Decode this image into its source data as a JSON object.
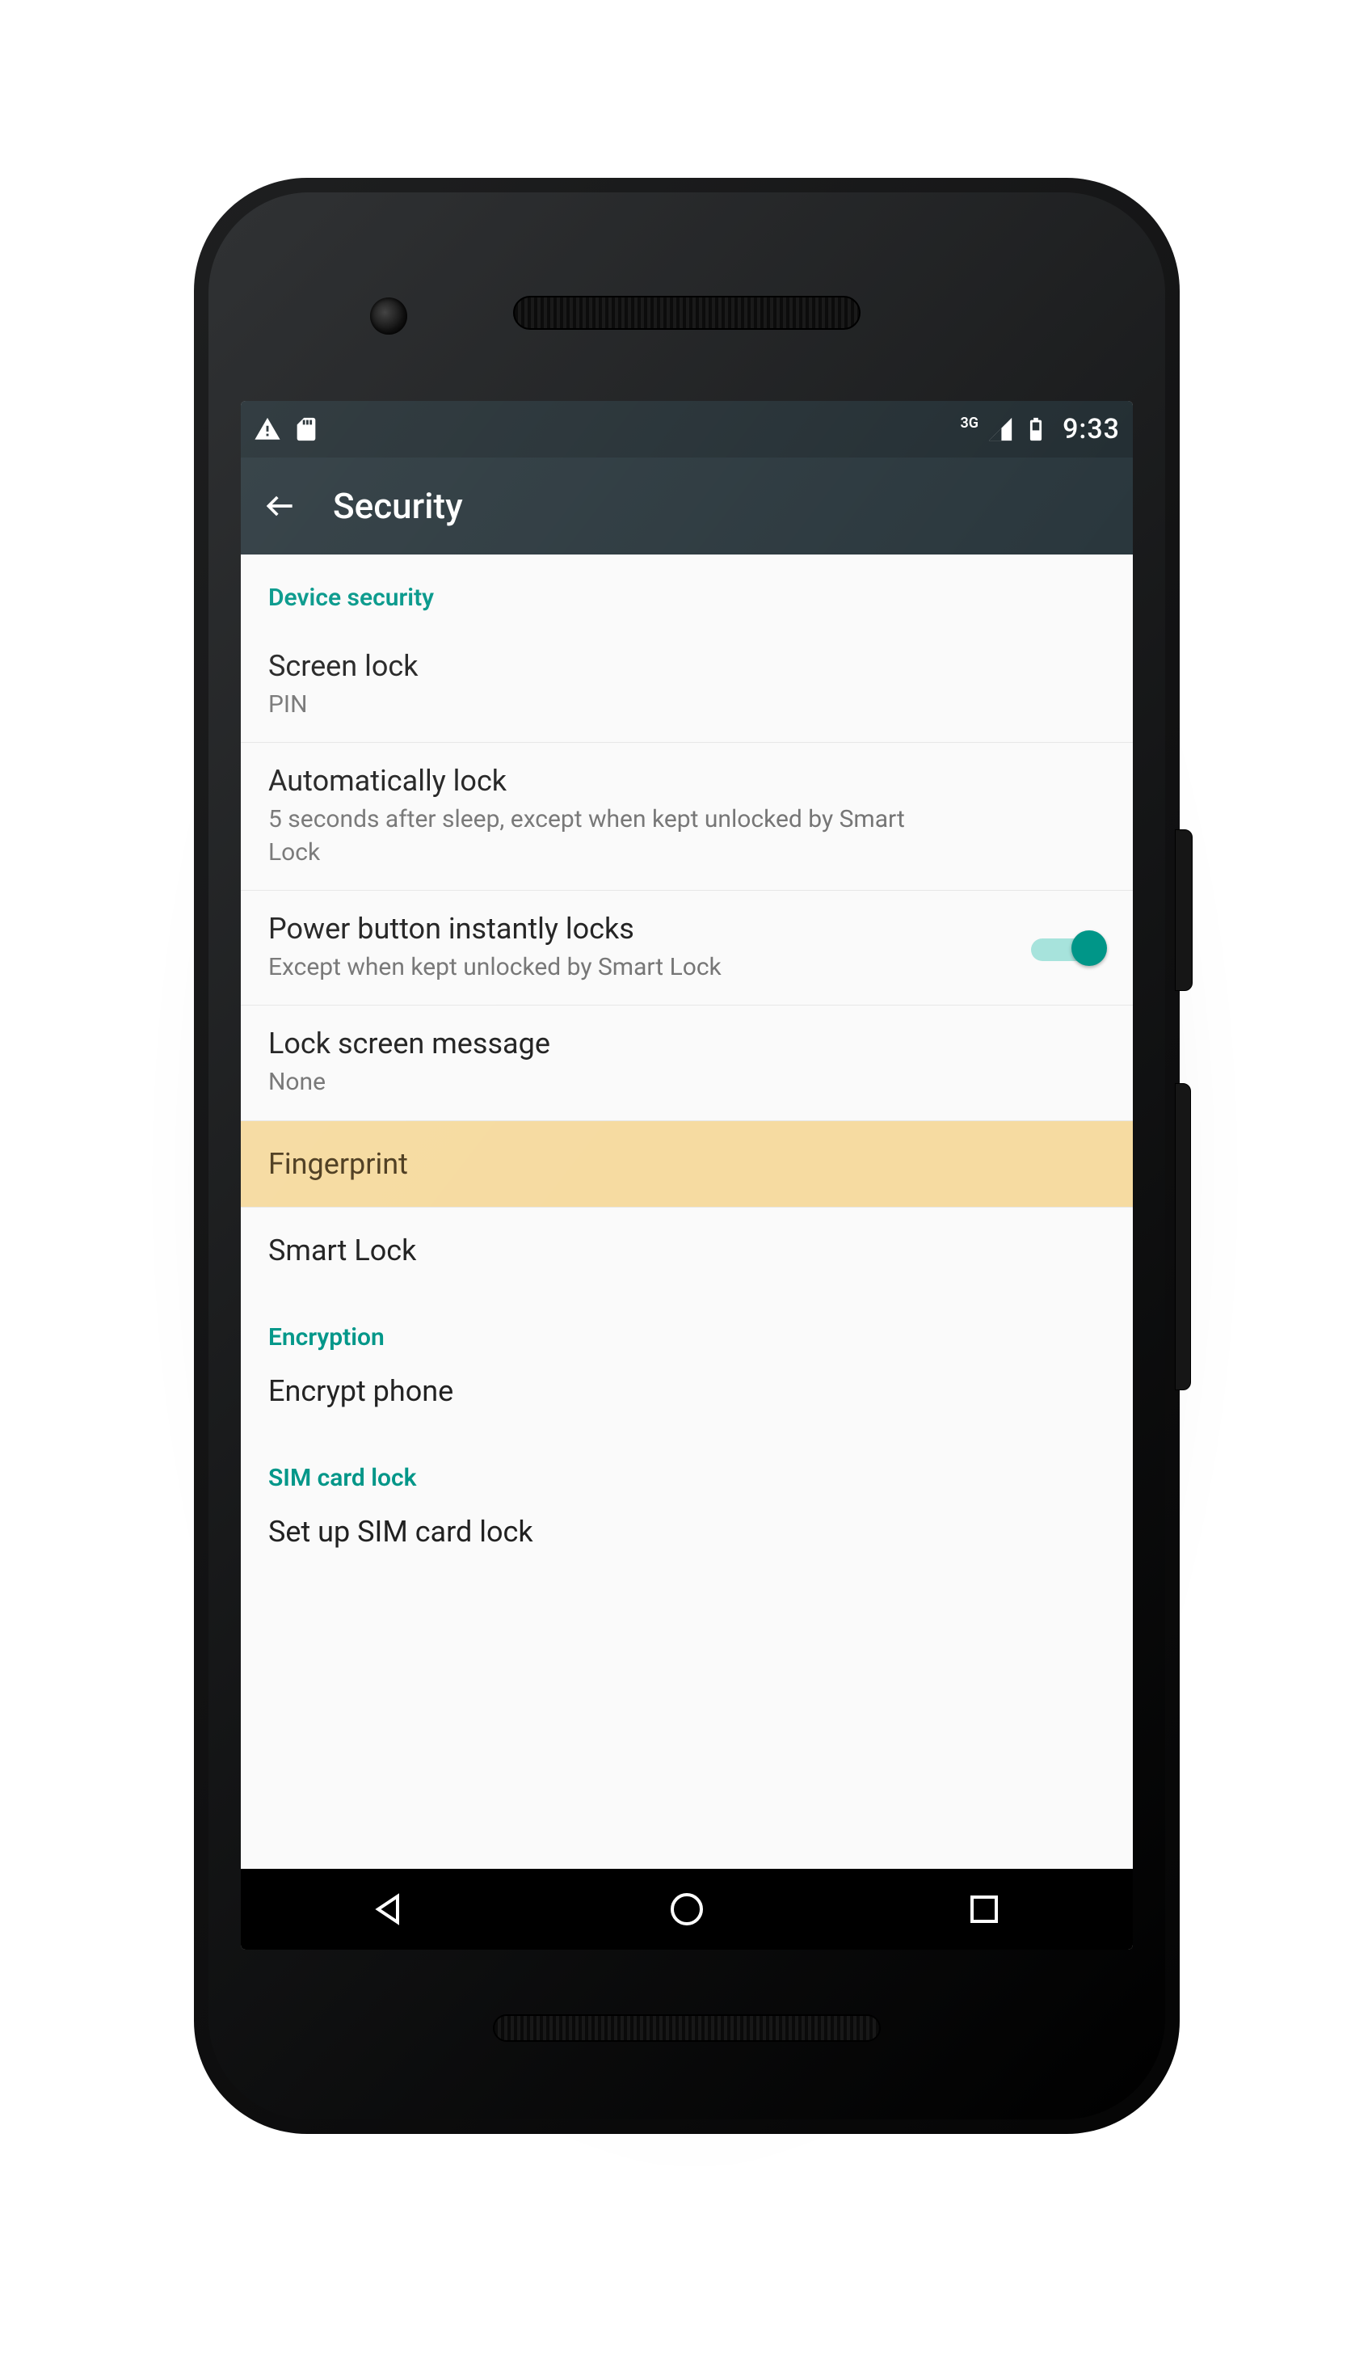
{
  "statusbar": {
    "time": "9:33",
    "network_label": "3G"
  },
  "actionbar": {
    "title": "Security"
  },
  "sections": {
    "device_security": "Device security",
    "encryption": "Encryption",
    "sim": "SIM card lock"
  },
  "rows": {
    "screen_lock": {
      "title": "Screen lock",
      "value": "PIN"
    },
    "auto_lock": {
      "title": "Automatically lock",
      "value": "5 seconds after sleep, except when kept unlocked by Smart Lock"
    },
    "power_lock": {
      "title": "Power button instantly locks",
      "value": "Except when kept unlocked by Smart Lock",
      "toggle": true
    },
    "lock_msg": {
      "title": "Lock screen message",
      "value": "None"
    },
    "fingerprint": {
      "title": "Fingerprint"
    },
    "smart_lock": {
      "title": "Smart Lock"
    },
    "encrypt": {
      "title": "Encrypt phone"
    },
    "sim_setup": {
      "title": "Set up SIM card lock"
    }
  },
  "colors": {
    "accent": "#009688",
    "highlight": "#f6dba1",
    "actionbar": "#2a373d",
    "statusbar": "#232e33"
  }
}
